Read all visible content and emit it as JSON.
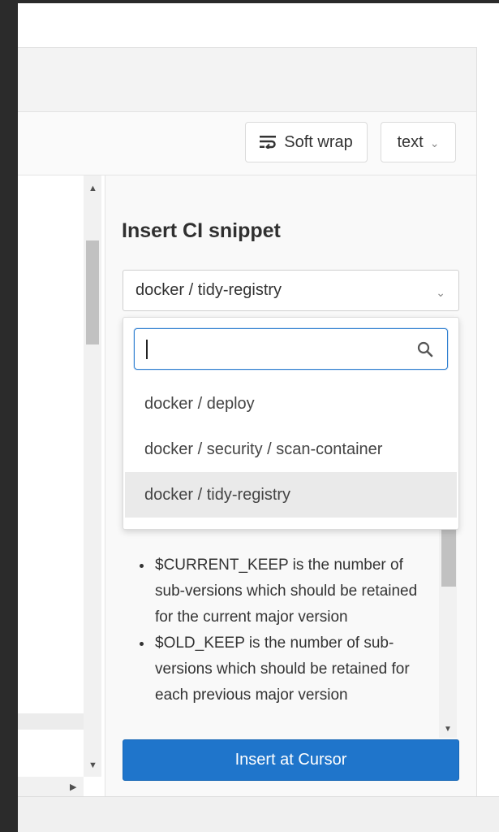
{
  "toolbar": {
    "soft_wrap_label": "Soft wrap",
    "file_type_label": "text"
  },
  "snippet_panel": {
    "title": "Insert CI snippet",
    "selected": "docker / tidy-registry",
    "search": {
      "value": "",
      "placeholder": ""
    },
    "options": [
      "docker / deploy",
      "docker / security / scan-container",
      "docker / tidy-registry"
    ],
    "description_items": [
      "$CURRENT_KEEP is the number of sub-versions which should be retained for the current major version",
      "$OLD_KEEP is the number of sub-versions which should be retained for each previous major version"
    ],
    "insert_button_label": "Insert at Cursor"
  },
  "icons": {
    "soft_wrap": "wrap-text-icon",
    "chevron": "chevron-down-icon",
    "search": "search-icon"
  },
  "colors": {
    "primary_button": "#1f75cb",
    "focus_border": "#2f7fd0"
  }
}
